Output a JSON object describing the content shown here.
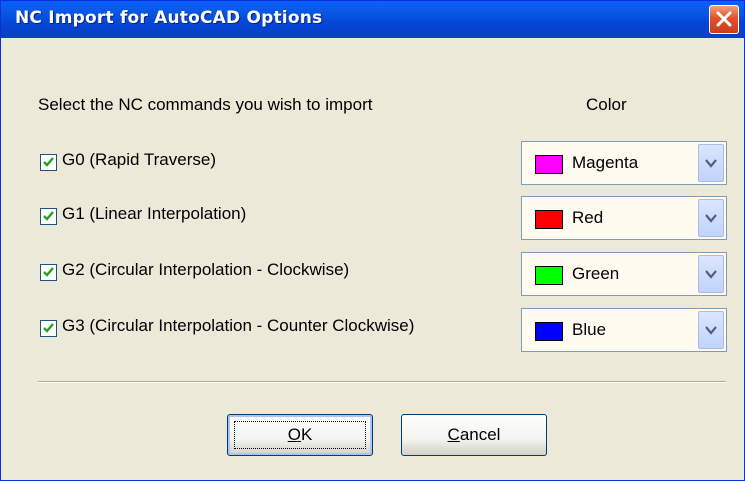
{
  "window": {
    "title": "NC Import for AutoCAD Options"
  },
  "header": {
    "prompt": "Select the NC commands you wish to import",
    "color_label": "Color"
  },
  "commands": [
    {
      "label": "G0 (Rapid Traverse)",
      "checked": true,
      "color_name": "Magenta",
      "color_hex": "#ff00ff"
    },
    {
      "label": "G1 (Linear Interpolation)",
      "checked": true,
      "color_name": "Red",
      "color_hex": "#ff0000"
    },
    {
      "label": "G2 (Circular Interpolation - Clockwise)",
      "checked": true,
      "color_name": "Green",
      "color_hex": "#00ff00"
    },
    {
      "label": "G3 (Circular Interpolation - Counter Clockwise)",
      "checked": true,
      "color_name": "Blue",
      "color_hex": "#0000ff"
    }
  ],
  "buttons": {
    "ok_label": "OK",
    "ok_mnemonic": "O",
    "cancel_label": "Cancel",
    "cancel_mnemonic": "C"
  },
  "icons": {
    "close": "close-icon",
    "checkbox": "checkmark-icon",
    "dropdown": "chevron-down-icon"
  },
  "colors": {
    "titlebar": "#0a5ae6",
    "dialog_bg": "#ece9d8",
    "combo_bg": "#fffbf0",
    "checkmark": "#21a121"
  }
}
